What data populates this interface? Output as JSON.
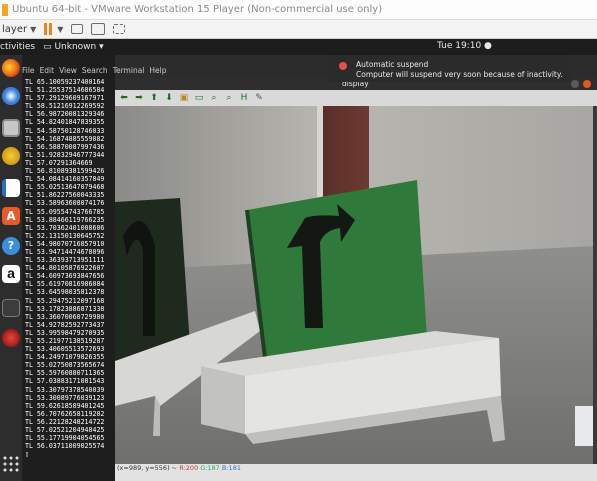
{
  "vmware": {
    "title": "Ubuntu 64-bit - VMware Workstation 15 Player (Non-commercial use only)",
    "menu_label": "layer",
    "toolbar_icons": [
      "pause-icon",
      "send-ctrl-alt-del-icon",
      "fullscreen-icon",
      "unity-icon"
    ]
  },
  "ubuntu_bar": {
    "activities": "ctivities",
    "app_menu": "Unknown",
    "clock": "Tue 19:10"
  },
  "terminal": {
    "menu": [
      "File",
      "Edit",
      "View",
      "Search",
      "Terminal",
      "Help"
    ],
    "lines": [
      "TL 65.10059237400164",
      "TL 51.25537514686584",
      "TL 57.29129609167971",
      "TL 58.51216912269592",
      "TL 56.98720081329346",
      "TL 54.82401847839355",
      "TL 54.58750128746033",
      "TL 54.16874885559082",
      "TL 56.58870087997436",
      "TL 51.92832946777344",
      "TL 57.07291364669",
      "TL 56.81089381599426",
      "TL 54.08414160357849",
      "TL 55.02513647079468",
      "TL 51.86227560043335",
      "TL 53.58963608074176",
      "TL 55.09554743766785",
      "TL 53.88466119766235",
      "TL 53.70362401008606",
      "TL 52.13150130645752",
      "TL 54.98070716857910",
      "TL 53.94714474678096",
      "TL 53.36393713951111",
      "TL 54.80105876922607",
      "TL 54.60973693847656",
      "TL 55.61970816986084",
      "TL 53.64598035812378",
      "TL 55.29475212097168",
      "TL 53.17823886871338",
      "TL 53.36070060729980",
      "TL 54.92782592773437",
      "TL 53.99598479270935",
      "TL 55.21977138519287",
      "TL 53.40605513572693",
      "TL 54.24971079826355",
      "TL 55.02750873565674",
      "TL 55.59760880711365",
      "TL 57.03883171081543",
      "TL 53.30797378540039",
      "TL 53.30089776039123",
      "TL 59.62618589401245",
      "TL 56.70762658119202",
      "TL 56.22128248214722",
      "TL 57.02521204948425",
      "TL 55.17719904054565",
      "TL 56.03711009025574"
    ]
  },
  "notification": {
    "title": "Automatic suspend",
    "body": "Computer will suspend very soon because of inactivity."
  },
  "display_window": {
    "title": "display",
    "toolbar_icons": [
      "arrow-left-icon",
      "arrow-right-icon",
      "arrow-up-icon",
      "arrow-down-icon",
      "save-image-icon",
      "properties-icon",
      "zoom-in-icon",
      "zoom-out-icon",
      "zoom-reset-icon",
      "pan-icon"
    ],
    "status_prefix": "(x=989, y=556) ~ ",
    "status_r": "R:200",
    "status_g": "G:187",
    "status_b": "B:181"
  },
  "dock": {
    "icons": [
      "firefox-icon",
      "thunderbird-icon",
      "files-icon",
      "rhythmbox-icon",
      "libreoffice-writer-icon",
      "software-center-icon",
      "help-icon",
      "amazon-icon",
      "terminal-icon",
      "system-settings-icon",
      "show-applications-icon"
    ]
  },
  "colors": {
    "ubuntu_orange": "#e95420",
    "vmware_orange": "#e8861a",
    "sign_green": "#2f7a3a"
  }
}
